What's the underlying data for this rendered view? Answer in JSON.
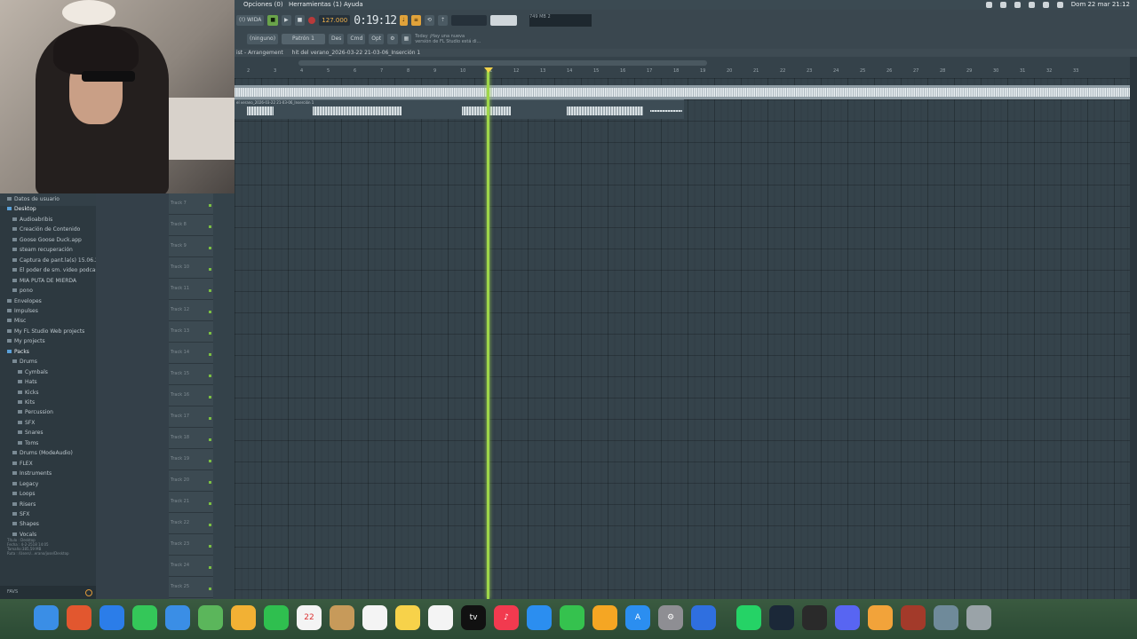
{
  "menubar": {
    "items": [
      "Opciones (0)",
      "Herramientas (1)",
      "Ayuda"
    ],
    "datetime": "Dom 22 mar  21:12"
  },
  "toolbar": {
    "mode_label": "(!) WIDA",
    "tempo": "127.000",
    "time": "0:19:12",
    "pattern_selector": "Patrón 1",
    "snap": "(ninguno)",
    "buttons": [
      "Des",
      "Cmd",
      "Opt"
    ],
    "hint_line1": "Today  ¡Hay una nueva",
    "hint_line2": "versión de FL Studio está di...",
    "cpu_label": "749 MB",
    "cpu_value": "2"
  },
  "playlist": {
    "title": "ist - Arrangement",
    "breadcrumb": "hit del verano_2026-03-22 21-03-06_Inserción 1",
    "clip_label": "el verano_2026-03-22 21-03-06_Inserción 1",
    "ruler_ticks": [
      "2",
      "3",
      "4",
      "5",
      "6",
      "7",
      "8",
      "9",
      "10",
      "11",
      "12",
      "13",
      "14",
      "15",
      "16",
      "17",
      "18",
      "19",
      "20",
      "21",
      "22",
      "23",
      "24",
      "25",
      "26",
      "27",
      "28",
      "29",
      "30",
      "31",
      "32",
      "33"
    ]
  },
  "browser": {
    "items": [
      {
        "label": "Datos de usuario",
        "indent": 1
      },
      {
        "label": "Desktop",
        "indent": 1,
        "selected": true
      },
      {
        "label": "Audioabribis",
        "indent": 2
      },
      {
        "label": "Creación de Contenido",
        "indent": 2
      },
      {
        "label": "Goose Goose Duck.app",
        "indent": 2
      },
      {
        "label": "steam recuperación",
        "indent": 2
      },
      {
        "label": "Captura de pant.la(s) 15.06.21",
        "indent": 2
      },
      {
        "label": "El poder de sm. video podcast",
        "indent": 2
      },
      {
        "label": "MIA PUTA DE MIERDA",
        "indent": 2
      },
      {
        "label": "pono",
        "indent": 2
      },
      {
        "label": "Envelopes",
        "indent": 1
      },
      {
        "label": "Impulses",
        "indent": 1
      },
      {
        "label": "Misc",
        "indent": 1
      },
      {
        "label": "My FL Studio Web projects",
        "indent": 1
      },
      {
        "label": "My projects",
        "indent": 1
      },
      {
        "label": "Packs",
        "indent": 1,
        "selected": true
      },
      {
        "label": "Drums",
        "indent": 2
      },
      {
        "label": "Cymbals",
        "indent": 3
      },
      {
        "label": "Hats",
        "indent": 3
      },
      {
        "label": "Kicks",
        "indent": 3
      },
      {
        "label": "Kits",
        "indent": 3
      },
      {
        "label": "Percussion",
        "indent": 3
      },
      {
        "label": "SFX",
        "indent": 3
      },
      {
        "label": "Snares",
        "indent": 3
      },
      {
        "label": "Toms",
        "indent": 3
      },
      {
        "label": "Drums (ModeAudio)",
        "indent": 2
      },
      {
        "label": "FLEX",
        "indent": 2
      },
      {
        "label": "Instruments",
        "indent": 2
      },
      {
        "label": "Legacy",
        "indent": 2
      },
      {
        "label": "Loops",
        "indent": 2
      },
      {
        "label": "Risers",
        "indent": 2
      },
      {
        "label": "SFX",
        "indent": 2
      },
      {
        "label": "Shapes",
        "indent": 2
      },
      {
        "label": "Vocals",
        "indent": 2
      }
    ],
    "info_lines": [
      "Título : Desktop",
      "Fecha : 4-2-2518 14:05",
      "Tamaño:385,59 MB",
      "Ruta : /Users/...erano/jose/Desktop"
    ],
    "footer": "FAVS"
  },
  "tracks": [
    "Track 7",
    "Track 8",
    "Track 9",
    "Track 10",
    "Track 11",
    "Track 12",
    "Track 13",
    "Track 14",
    "Track 15",
    "Track 16",
    "Track 17",
    "Track 18",
    "Track 19",
    "Track 20",
    "Track 21",
    "Track 22",
    "Track 23",
    "Track 24",
    "Track 25"
  ],
  "dock": {
    "apps": [
      {
        "name": "finder-icon",
        "color": "#3a8ee6",
        "glyph": ""
      },
      {
        "name": "launchpad-icon",
        "color": "#e2572f",
        "glyph": ""
      },
      {
        "name": "safari-icon",
        "color": "#2b7de9",
        "glyph": ""
      },
      {
        "name": "messages-icon",
        "color": "#34c759",
        "glyph": ""
      },
      {
        "name": "mail-icon",
        "color": "#3a8ee6",
        "glyph": ""
      },
      {
        "name": "maps-icon",
        "color": "#5bb65b",
        "glyph": ""
      },
      {
        "name": "photos-icon",
        "color": "#f2b134",
        "glyph": ""
      },
      {
        "name": "facetime-icon",
        "color": "#2fbf4f",
        "glyph": ""
      },
      {
        "name": "calendar-icon",
        "color": "#f4f4f4",
        "glyph": "22"
      },
      {
        "name": "contacts-icon",
        "color": "#c79a5a",
        "glyph": ""
      },
      {
        "name": "reminders-icon",
        "color": "#f4f4f4",
        "glyph": ""
      },
      {
        "name": "notes-icon",
        "color": "#f7d24a",
        "glyph": ""
      },
      {
        "name": "freeform-icon",
        "color": "#f4f4f4",
        "glyph": ""
      },
      {
        "name": "apple-tv-icon",
        "color": "#111111",
        "glyph": "tv"
      },
      {
        "name": "music-icon",
        "color": "#f23a4f",
        "glyph": "♪"
      },
      {
        "name": "keynote-icon",
        "color": "#2b8ef0",
        "glyph": ""
      },
      {
        "name": "numbers-icon",
        "color": "#35c24e",
        "glyph": ""
      },
      {
        "name": "pages-icon",
        "color": "#f5a623",
        "glyph": ""
      },
      {
        "name": "app-store-icon",
        "color": "#2b8ef0",
        "glyph": "A"
      },
      {
        "name": "system-settings-icon",
        "color": "#8e8e93",
        "glyph": "⚙"
      },
      {
        "name": "roblox-icon",
        "color": "#2f6fe0",
        "glyph": ""
      },
      {
        "name": "whatsapp-icon",
        "color": "#25d366",
        "glyph": ""
      },
      {
        "name": "steam-icon",
        "color": "#1b2838",
        "glyph": ""
      },
      {
        "name": "obs-icon",
        "color": "#2a2a2a",
        "glyph": ""
      },
      {
        "name": "discord-icon",
        "color": "#5865f2",
        "glyph": ""
      },
      {
        "name": "fl-studio-icon",
        "color": "#f2a33a",
        "glyph": ""
      },
      {
        "name": "project-icon",
        "color": "#a33a2a",
        "glyph": ""
      },
      {
        "name": "downloads-stack-icon",
        "color": "#6f8a9a",
        "glyph": ""
      },
      {
        "name": "trash-icon",
        "color": "#9aa3a8",
        "glyph": ""
      }
    ]
  }
}
